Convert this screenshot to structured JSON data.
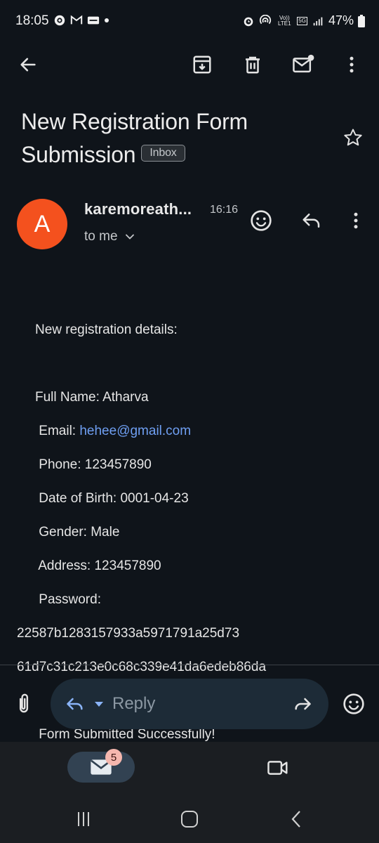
{
  "status_bar": {
    "time": "18:05",
    "battery": "47%",
    "left_icons": [
      "threads-icon",
      "gmail-icon",
      "paytm-icon",
      "dot-icon"
    ],
    "volte_label": "Vo)) LTE1",
    "fiveg_label": "5G"
  },
  "toolbar": {
    "icons": [
      "back-arrow-icon",
      "archive-icon",
      "delete-icon",
      "mark-unread-icon",
      "more-vert-icon"
    ]
  },
  "email": {
    "subject": "New Registration Form Submission",
    "label_chip": "Inbox",
    "sender_initial": "A",
    "sender_name": "karemoreath...",
    "time": "16:16",
    "recipient": "to me",
    "body": {
      "intro": "New registration details:",
      "full_name": "Full Name: Atharva",
      "email_label": " Email: ",
      "email_value": "hehee@gmail.com",
      "phone": " Phone: 123457890",
      "dob": " Date of Birth: 0001-04-23",
      "gender": " Gender: Male",
      "address": " Address: 123457890",
      "password_label": " Password:",
      "password_line1": "22587b1283157933a5971791a25d73",
      "password_line2": "61d7c31c213e0c68c339e41da6edeb86da",
      "footer": " Form Submitted Successfully!"
    }
  },
  "reply_bar": {
    "reply_label": "Reply"
  },
  "bottom_nav": {
    "mail_badge": "5"
  },
  "colors": {
    "background": "#0f141a",
    "avatar": "#f4511e",
    "link": "#6f9ff2",
    "reply_pill": "#1d2b37"
  }
}
